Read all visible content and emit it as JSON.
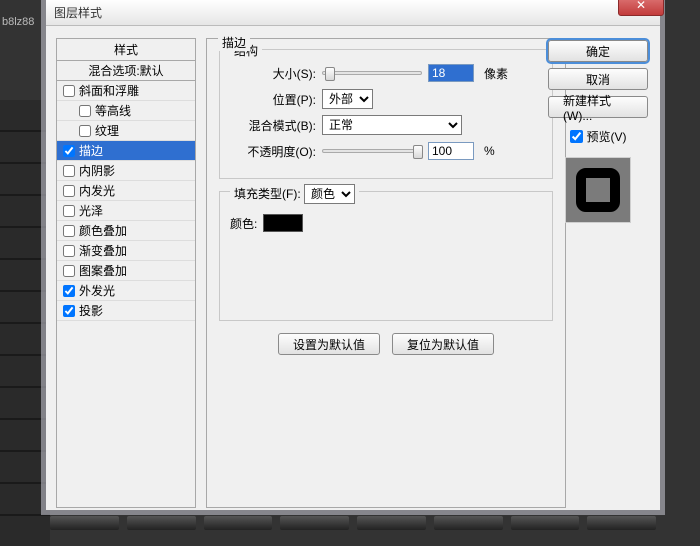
{
  "bg_text": "b8lz88",
  "dialog": {
    "title": "图层样式"
  },
  "sidebar": {
    "header": "样式",
    "blend": "混合选项:默认",
    "items": [
      {
        "label": "斜面和浮雕",
        "checked": false,
        "indent": false
      },
      {
        "label": "等高线",
        "checked": false,
        "indent": true
      },
      {
        "label": "纹理",
        "checked": false,
        "indent": true
      },
      {
        "label": "描边",
        "checked": true,
        "indent": false,
        "selected": true
      },
      {
        "label": "内阴影",
        "checked": false,
        "indent": false
      },
      {
        "label": "内发光",
        "checked": false,
        "indent": false
      },
      {
        "label": "光泽",
        "checked": false,
        "indent": false
      },
      {
        "label": "颜色叠加",
        "checked": false,
        "indent": false
      },
      {
        "label": "渐变叠加",
        "checked": false,
        "indent": false
      },
      {
        "label": "图案叠加",
        "checked": false,
        "indent": false
      },
      {
        "label": "外发光",
        "checked": true,
        "indent": false
      },
      {
        "label": "投影",
        "checked": true,
        "indent": false
      }
    ]
  },
  "center": {
    "panel_title": "描边",
    "structure_legend": "结构",
    "size_label": "大小(S):",
    "size_value": "18",
    "size_unit": "像素",
    "position_label": "位置(P):",
    "position_value": "外部",
    "blend_label": "混合模式(B):",
    "blend_value": "正常",
    "opacity_label": "不透明度(O):",
    "opacity_value": "100",
    "opacity_unit": "%",
    "filltype_label": "填充类型(F):",
    "filltype_value": "颜色",
    "color_label": "颜色:",
    "color_value": "#000000",
    "set_default": "设置为默认值",
    "reset_default": "复位为默认值"
  },
  "right": {
    "ok": "确定",
    "cancel": "取消",
    "new_style": "新建样式(W)...",
    "preview": "预览(V)"
  }
}
